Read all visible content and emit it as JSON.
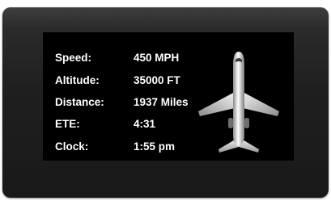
{
  "display": {
    "rows": [
      {
        "label": "Speed:",
        "value": "450 MPH"
      },
      {
        "label": "Altitude:",
        "value": "35000 FT"
      },
      {
        "label": "Distance:",
        "value": "1937 Miles"
      },
      {
        "label": "ETE:",
        "value": "4:31"
      },
      {
        "label": "Clock:",
        "value": "1:55 pm"
      }
    ],
    "icon": "airplane-icon"
  },
  "colors": {
    "bezel": "#222222",
    "screen": "#000000",
    "text": "#ffffff"
  }
}
